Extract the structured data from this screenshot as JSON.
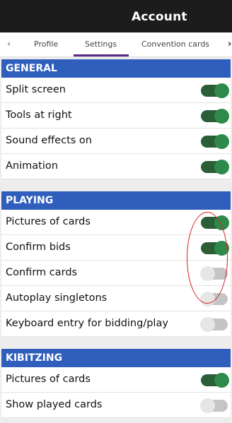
{
  "header": {
    "title": "Account"
  },
  "tabs": {
    "items": [
      {
        "label": "Profile"
      },
      {
        "label": "Settings"
      },
      {
        "label": "Convention cards"
      }
    ],
    "left_arrow": "‹",
    "right_arrow": "›",
    "active": "Settings"
  },
  "sections": {
    "general": {
      "title": "GENERAL",
      "items": [
        {
          "label": "Split screen",
          "on": true
        },
        {
          "label": "Tools at right",
          "on": true
        },
        {
          "label": "Sound effects on",
          "on": true
        },
        {
          "label": "Animation",
          "on": true
        }
      ]
    },
    "playing": {
      "title": "PLAYING",
      "items": [
        {
          "label": "Pictures of cards",
          "on": true
        },
        {
          "label": "Confirm bids",
          "on": true
        },
        {
          "label": "Confirm cards",
          "on": false
        },
        {
          "label": "Autoplay singletons",
          "on": false
        },
        {
          "label": "Keyboard entry for bidding/play",
          "on": false
        }
      ]
    },
    "kibitzing": {
      "title": "KIBITZING",
      "items": [
        {
          "label": "Pictures of cards",
          "on": true
        },
        {
          "label": "Show played cards",
          "on": false
        }
      ]
    }
  },
  "colors": {
    "header_bg": "#1c1c1c",
    "section_bg": "#2f5ebd",
    "toggle_on_track": "#2b5d36",
    "toggle_on_knob": "#2e8a4b",
    "toggle_off_track": "#c5c5c5",
    "annotation": "#d42020",
    "tab_underline": "#5a2a86"
  }
}
